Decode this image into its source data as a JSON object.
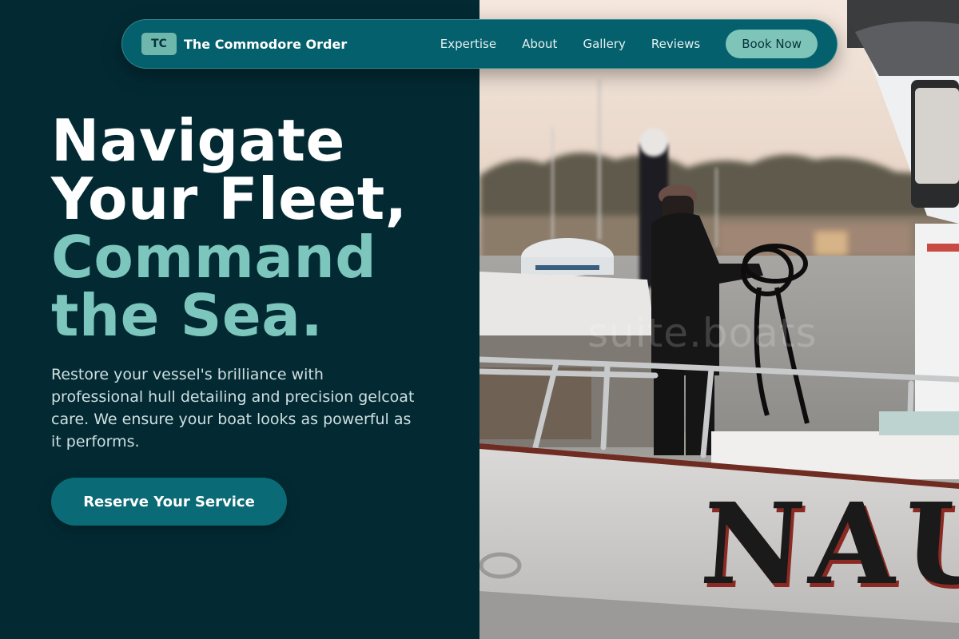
{
  "brand": {
    "badge": "TC",
    "name": "The Commodore Order"
  },
  "nav": {
    "items": [
      {
        "label": "Expertise"
      },
      {
        "label": "About"
      },
      {
        "label": "Gallery"
      },
      {
        "label": "Reviews"
      }
    ],
    "book_label": "Book Now"
  },
  "hero": {
    "title_lines": [
      "Navigate",
      "Your Fleet,",
      "Command",
      "the Sea."
    ],
    "description": "Restore your vessel's brilliance with professional hull detailing and precision gelcoat care. We ensure your boat looks as powerful as it performs.",
    "cta_label": "Reserve Your Service"
  },
  "photo": {
    "watermark": "suite.boats",
    "hull_lettering": "NAU"
  },
  "colors": {
    "background": "#032a33",
    "nav_bg": "#04606c",
    "accent": "#7cc6bd",
    "cta_bg": "#0a6a76",
    "book_bg": "#7ec4b9"
  }
}
